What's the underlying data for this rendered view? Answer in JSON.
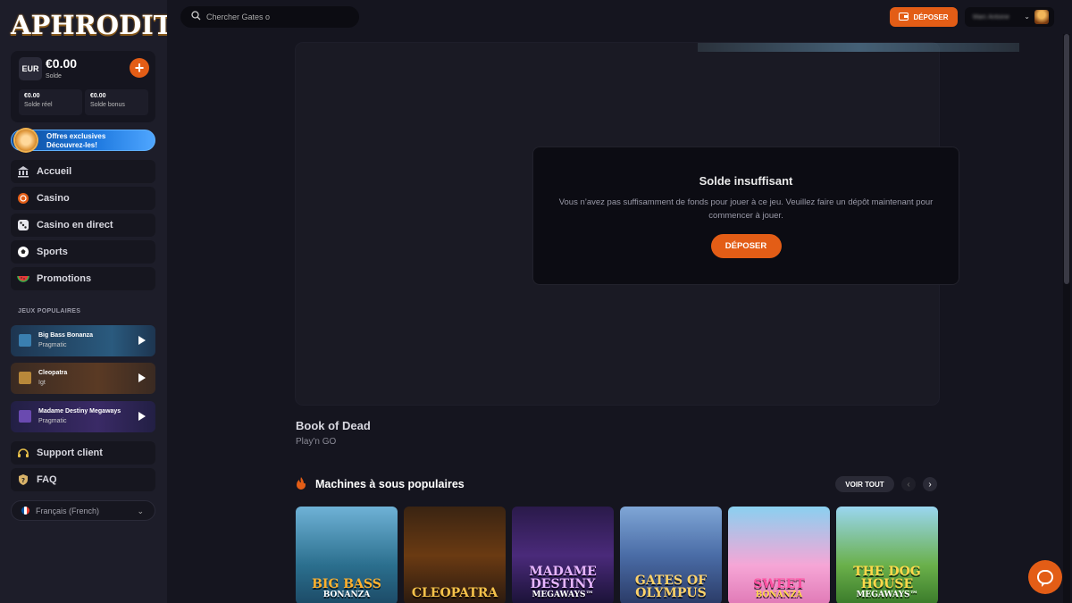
{
  "brand": {
    "logo_text": "APHRODITE"
  },
  "wallet": {
    "currency": "EUR",
    "balance": "€0.00",
    "balance_label": "Solde",
    "real_value": "€0.00",
    "real_label": "Solde réel",
    "bonus_value": "€0.00",
    "bonus_label": "Solde bonus",
    "add_icon": "plus-icon"
  },
  "promo": {
    "line1": "Offres exclusives",
    "line2": "Découvrez-les!"
  },
  "nav": {
    "items": [
      {
        "label": "Accueil",
        "icon": "bank-icon"
      },
      {
        "label": "Casino",
        "icon": "chip-icon"
      },
      {
        "label": "Casino en direct",
        "icon": "dice-icon"
      },
      {
        "label": "Sports",
        "icon": "soccer-ball-icon"
      },
      {
        "label": "Promotions",
        "icon": "watermelon-icon"
      }
    ]
  },
  "popular": {
    "title": "JEUX POPULAIRES",
    "games": [
      {
        "name": "Big Bass Bonanza",
        "provider": "Pragmatic"
      },
      {
        "name": "Cleopatra",
        "provider": "Igt"
      },
      {
        "name": "Madame Destiny Megaways",
        "provider": "Pragmatic"
      }
    ]
  },
  "support": {
    "support_label": "Support client",
    "faq_label": "FAQ"
  },
  "language": {
    "label": "Français (French)"
  },
  "topbar": {
    "search_placeholder": "Chercher Gates o",
    "deposit_label": "DÉPOSER",
    "username": "Marc Antoine"
  },
  "modal": {
    "title": "Solde insuffisant",
    "message": "Vous n’avez pas suffisamment de fonds pour jouer à ce jeu. Veuillez faire un dépôt maintenant pour commencer à jouer.",
    "button": "DÉPOSER"
  },
  "current_game": {
    "title": "Book of Dead",
    "provider": "Play'n GO"
  },
  "slots_section": {
    "title": "Machines à sous populaires",
    "see_all": "VOIR TOUT",
    "tiles": [
      {
        "title": "BIG BASS",
        "subtitle": "BONANZA"
      },
      {
        "title": "CLEOPATRA",
        "subtitle": ""
      },
      {
        "title": "MADAME DESTINY",
        "subtitle": "MEGAWAYS™"
      },
      {
        "title": "GATES OF OLYMPUS",
        "subtitle": ""
      },
      {
        "title": "SWEET",
        "subtitle": "BONANZA"
      },
      {
        "title": "THE DOG HOUSE",
        "subtitle": "MEGAWAYS™"
      }
    ]
  },
  "colors": {
    "accent": "#e35d16",
    "background": "#15151f",
    "sidebar": "#1d1d29"
  }
}
